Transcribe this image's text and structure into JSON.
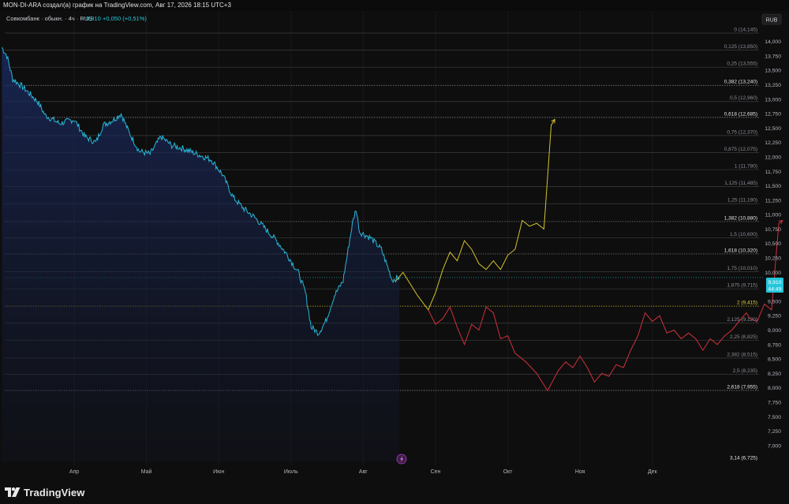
{
  "header": {
    "caption": "MON-DI-ARA создал(а) график на TradingView.com, Авг 17, 2026 18:15 UTC+3"
  },
  "symbol": {
    "name": "Совкомбанк · обыкн. · 4ч · RUS",
    "price": "9,910",
    "change": "+0,050 (+0,51%)",
    "currency": "RUB"
  },
  "price_tag": {
    "value": "9,910",
    "timer": "44:49"
  },
  "brand": {
    "name": "TradingView"
  },
  "events": {
    "icon": "lightning-icon"
  },
  "chart_data": {
    "type": "line",
    "y_axis_ticks": [
      "14,000",
      "13,750",
      "13,500",
      "13,250",
      "13,000",
      "12,750",
      "12,500",
      "12,250",
      "12,000",
      "11,750",
      "11,500",
      "11,250",
      "11,000",
      "10,750",
      "10,500",
      "10,250",
      "10,000",
      "9,750",
      "9,500",
      "9,250",
      "9,000",
      "8,750",
      "8,500",
      "8,250",
      "8,000",
      "7,750",
      "7,500",
      "7,250",
      "7,000"
    ],
    "y_axis_values": [
      14000,
      13750,
      13500,
      13250,
      13000,
      12750,
      12500,
      12250,
      12000,
      11750,
      11500,
      11250,
      11000,
      10750,
      10500,
      10250,
      10000,
      9750,
      9500,
      9250,
      9000,
      8750,
      8500,
      8250,
      8000,
      7750,
      7500,
      7250,
      7000
    ],
    "x_axis_ticks": [
      "Апр",
      "Май",
      "Июн",
      "Июль",
      "Авг",
      "Сен",
      "Окт",
      "Ноя",
      "Дек"
    ],
    "ylim": [
      6625,
      14250
    ],
    "fib_levels": [
      {
        "label": "0 (14,145)",
        "value": 14145,
        "highlight": false
      },
      {
        "label": "0,125 (13,850)",
        "value": 13850,
        "highlight": false
      },
      {
        "label": "0,25 (13,555)",
        "value": 13555,
        "highlight": false
      },
      {
        "label": "0,382 (13,240)",
        "value": 13240,
        "highlight": true
      },
      {
        "label": "0,5 (12,960)",
        "value": 12960,
        "highlight": false
      },
      {
        "label": "0,618 (12,685)",
        "value": 12685,
        "highlight": true
      },
      {
        "label": "0,75 (12,370)",
        "value": 12370,
        "highlight": false
      },
      {
        "label": "0,875 (12,075)",
        "value": 12075,
        "highlight": false
      },
      {
        "label": "1 (11,780)",
        "value": 11780,
        "highlight": false
      },
      {
        "label": "1,125 (11,485)",
        "value": 11485,
        "highlight": false
      },
      {
        "label": "1,25 (11,190)",
        "value": 11190,
        "highlight": false
      },
      {
        "label": "1,382 (10,880)",
        "value": 10880,
        "highlight": true
      },
      {
        "label": "1,5 (10,600)",
        "value": 10600,
        "highlight": false
      },
      {
        "label": "1,618 (10,320)",
        "value": 10320,
        "highlight": true
      },
      {
        "label": "1,75 (10,010)",
        "value": 10010,
        "highlight": false
      },
      {
        "label": "1,875 (9,715)",
        "value": 9715,
        "highlight": false
      },
      {
        "label": "2 (9,415)",
        "value": 9415,
        "highlight": "yellow"
      },
      {
        "label": "2,125 (9,120)",
        "value": 9120,
        "highlight": false
      },
      {
        "label": "2,25 (8,825)",
        "value": 8825,
        "highlight": false
      },
      {
        "label": "2,382 (8,515)",
        "value": 8515,
        "highlight": false
      },
      {
        "label": "2,5 (8,235)",
        "value": 8235,
        "highlight": false
      },
      {
        "label": "2,618 (7,955)",
        "value": 7955,
        "highlight": true
      },
      {
        "label": "3,14 (6,725)",
        "value": 6725,
        "highlight": true
      }
    ],
    "price_series": {
      "color": "#29b6d8",
      "points": [
        [
          0.0,
          13900
        ],
        [
          0.07,
          13750
        ],
        [
          0.15,
          13350
        ],
        [
          0.3,
          13200
        ],
        [
          0.5,
          12950
        ],
        [
          0.6,
          12720
        ],
        [
          0.8,
          12580
        ],
        [
          1.0,
          12650
        ],
        [
          1.15,
          12350
        ],
        [
          1.3,
          12250
        ],
        [
          1.4,
          12550
        ],
        [
          1.55,
          12650
        ],
        [
          1.65,
          12750
        ],
        [
          1.75,
          12450
        ],
        [
          1.9,
          12100
        ],
        [
          2.05,
          12050
        ],
        [
          2.2,
          12350
        ],
        [
          2.35,
          12200
        ],
        [
          2.5,
          12150
        ],
        [
          2.7,
          12050
        ],
        [
          2.9,
          11950
        ],
        [
          3.05,
          11700
        ],
        [
          3.2,
          11300
        ],
        [
          3.35,
          11100
        ],
        [
          3.5,
          10950
        ],
        [
          3.65,
          10750
        ],
        [
          3.8,
          10550
        ],
        [
          3.95,
          10300
        ],
        [
          4.1,
          10000
        ],
        [
          4.2,
          9650
        ],
        [
          4.28,
          9050
        ],
        [
          4.38,
          8950
        ],
        [
          4.48,
          9150
        ],
        [
          4.6,
          9600
        ],
        [
          4.72,
          9850
        ],
        [
          4.85,
          10850
        ],
        [
          4.9,
          11100
        ],
        [
          4.95,
          10700
        ],
        [
          5.1,
          10600
        ],
        [
          5.25,
          10400
        ],
        [
          5.35,
          10050
        ],
        [
          5.4,
          9870
        ],
        [
          5.5,
          9910
        ]
      ]
    },
    "projection_yellow": {
      "color": "#d4c22c",
      "points": [
        [
          5.45,
          9850
        ],
        [
          5.55,
          10000
        ],
        [
          5.75,
          9600
        ],
        [
          5.9,
          9350
        ],
        [
          6.0,
          9650
        ],
        [
          6.1,
          10050
        ],
        [
          6.2,
          10350
        ],
        [
          6.3,
          10200
        ],
        [
          6.4,
          10550
        ],
        [
          6.5,
          10400
        ],
        [
          6.6,
          10150
        ],
        [
          6.7,
          10050
        ],
        [
          6.8,
          10200
        ],
        [
          6.9,
          10050
        ],
        [
          7.0,
          10300
        ],
        [
          7.1,
          10400
        ],
        [
          7.2,
          10900
        ],
        [
          7.3,
          10800
        ],
        [
          7.4,
          10850
        ],
        [
          7.5,
          10750
        ],
        [
          7.6,
          12550
        ],
        [
          7.65,
          12650
        ]
      ]
    },
    "projection_red": {
      "color": "#d0303c",
      "points": [
        [
          5.9,
          9350
        ],
        [
          6.0,
          9100
        ],
        [
          6.1,
          9200
        ],
        [
          6.2,
          9400
        ],
        [
          6.3,
          9050
        ],
        [
          6.4,
          8750
        ],
        [
          6.5,
          9100
        ],
        [
          6.6,
          9000
        ],
        [
          6.7,
          9400
        ],
        [
          6.8,
          9300
        ],
        [
          6.9,
          8850
        ],
        [
          7.0,
          8900
        ],
        [
          7.1,
          8600
        ],
        [
          7.25,
          8450
        ],
        [
          7.4,
          8250
        ],
        [
          7.55,
          7950
        ],
        [
          7.7,
          8300
        ],
        [
          7.8,
          8450
        ],
        [
          7.9,
          8350
        ],
        [
          8.0,
          8550
        ],
        [
          8.1,
          8350
        ],
        [
          8.2,
          8100
        ],
        [
          8.3,
          8250
        ],
        [
          8.4,
          8200
        ],
        [
          8.5,
          8400
        ],
        [
          8.6,
          8350
        ],
        [
          8.7,
          8650
        ],
        [
          8.8,
          8900
        ],
        [
          8.9,
          9300
        ],
        [
          9.0,
          9150
        ],
        [
          9.1,
          9250
        ],
        [
          9.2,
          8950
        ],
        [
          9.3,
          9000
        ],
        [
          9.4,
          8850
        ],
        [
          9.5,
          8950
        ],
        [
          9.6,
          8850
        ],
        [
          9.7,
          8650
        ],
        [
          9.8,
          8850
        ],
        [
          9.9,
          8750
        ],
        [
          10.0,
          8900
        ],
        [
          10.1,
          9000
        ],
        [
          10.2,
          9150
        ],
        [
          10.3,
          9300
        ],
        [
          10.35,
          9200
        ],
        [
          10.45,
          9150
        ],
        [
          10.55,
          9450
        ],
        [
          10.65,
          9350
        ],
        [
          10.75,
          10850
        ],
        [
          10.8,
          10900
        ]
      ]
    }
  }
}
